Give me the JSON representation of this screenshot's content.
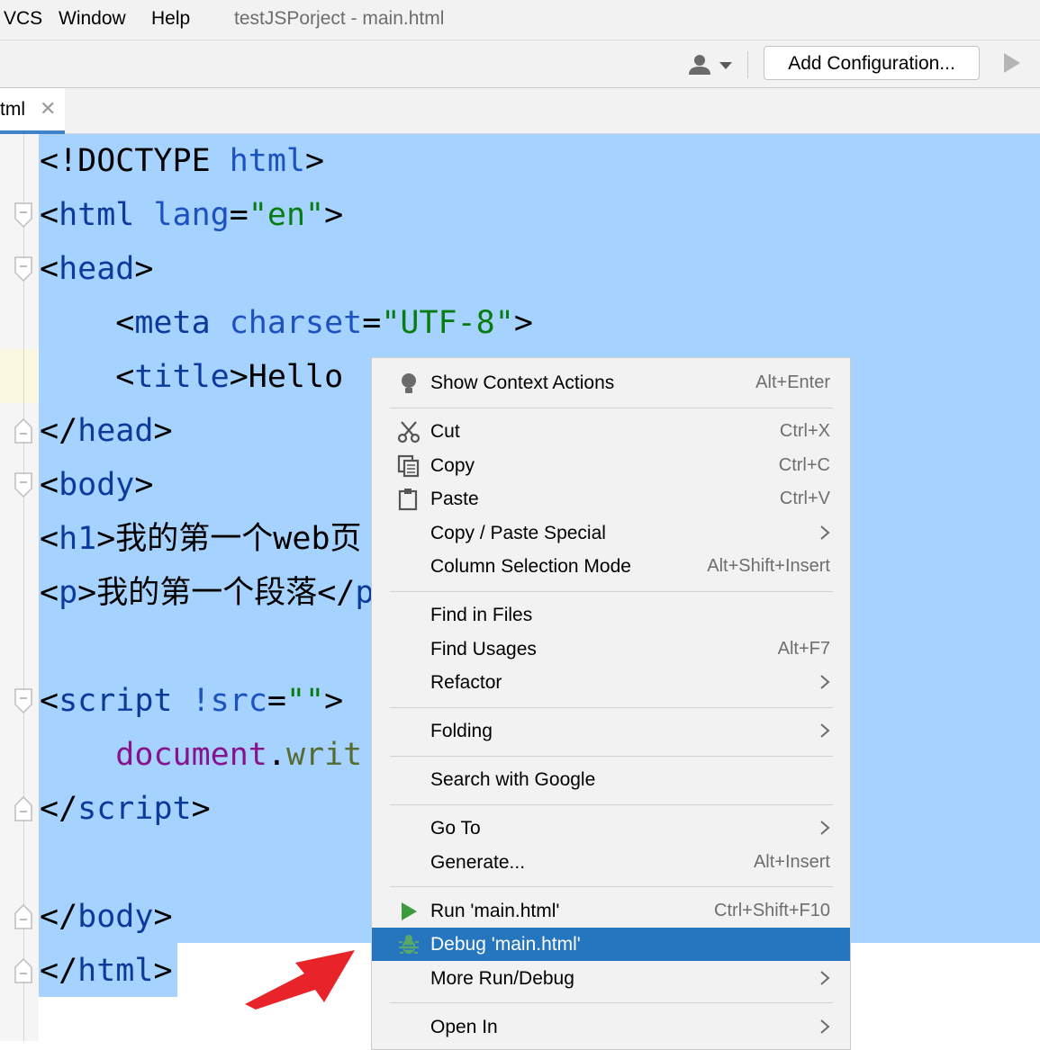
{
  "menubar": {
    "items": [
      "VCS",
      "Window",
      "Help"
    ],
    "title": "testJSPorject - main.html"
  },
  "toolbar": {
    "user_icon": "user-icon",
    "config_label": "Add Configuration...",
    "run_icon": "run-icon"
  },
  "tab": {
    "label": "tml",
    "close": "✕"
  },
  "code_lines": [
    [
      {
        "t": "<!DOCTYPE ",
        "c": ""
      },
      {
        "t": "html",
        "c": "at"
      },
      {
        "t": ">",
        "c": ""
      }
    ],
    [
      {
        "t": "<",
        "c": ""
      },
      {
        "t": "html ",
        "c": "tg"
      },
      {
        "t": "lang",
        "c": "at"
      },
      {
        "t": "=",
        "c": ""
      },
      {
        "t": "\"en\"",
        "c": "sv"
      },
      {
        "t": ">",
        "c": ""
      }
    ],
    [
      {
        "t": "<",
        "c": ""
      },
      {
        "t": "head",
        "c": "tg"
      },
      {
        "t": ">",
        "c": ""
      }
    ],
    [
      {
        "t": "    <",
        "c": ""
      },
      {
        "t": "meta ",
        "c": "tg"
      },
      {
        "t": "charset",
        "c": "at"
      },
      {
        "t": "=",
        "c": ""
      },
      {
        "t": "\"UTF-8\"",
        "c": "sv"
      },
      {
        "t": ">",
        "c": ""
      }
    ],
    [
      {
        "t": "    <",
        "c": ""
      },
      {
        "t": "title",
        "c": "tg"
      },
      {
        "t": ">Hello",
        "c": ""
      }
    ],
    [
      {
        "t": "</",
        "c": ""
      },
      {
        "t": "head",
        "c": "tg"
      },
      {
        "t": ">",
        "c": ""
      }
    ],
    [
      {
        "t": "<",
        "c": ""
      },
      {
        "t": "body",
        "c": "tg"
      },
      {
        "t": ">",
        "c": ""
      }
    ],
    [
      {
        "t": "<",
        "c": ""
      },
      {
        "t": "h1",
        "c": "tg"
      },
      {
        "t": ">我的第一个web页",
        "c": ""
      }
    ],
    [
      {
        "t": "<",
        "c": ""
      },
      {
        "t": "p",
        "c": "tg"
      },
      {
        "t": ">我的第一个段落</",
        "c": ""
      },
      {
        "t": "p",
        "c": "tg"
      }
    ],
    [],
    [
      {
        "t": "<",
        "c": ""
      },
      {
        "t": "script ",
        "c": "tg"
      },
      {
        "t": "!src",
        "c": "at"
      },
      {
        "t": "=",
        "c": ""
      },
      {
        "t": "\"\"",
        "c": "sv"
      },
      {
        "t": ">",
        "c": ""
      }
    ],
    [
      {
        "t": "    ",
        "c": ""
      },
      {
        "t": "document",
        "c": "js"
      },
      {
        "t": ".",
        "c": ""
      },
      {
        "t": "writ",
        "c": "fn"
      }
    ],
    [
      {
        "t": "</",
        "c": ""
      },
      {
        "t": "script",
        "c": "tg"
      },
      {
        "t": ">",
        "c": ""
      }
    ],
    [],
    [
      {
        "t": "</",
        "c": ""
      },
      {
        "t": "body",
        "c": "tg"
      },
      {
        "t": ">",
        "c": ""
      }
    ],
    [
      {
        "t": "</",
        "c": ""
      },
      {
        "t": "html",
        "c": "tg"
      },
      {
        "t": ">",
        "c": ""
      }
    ]
  ],
  "context_menu": {
    "items": [
      {
        "label": "Show Context Actions",
        "shortcut": "Alt+Enter",
        "icon": "lightbulb-icon"
      },
      {
        "sep": true
      },
      {
        "label": "Cut",
        "shortcut": "Ctrl+X",
        "icon": "scissors-icon"
      },
      {
        "label": "Copy",
        "shortcut": "Ctrl+C",
        "icon": "copy-icon"
      },
      {
        "label": "Paste",
        "shortcut": "Ctrl+V",
        "icon": "paste-icon"
      },
      {
        "label": "Copy / Paste Special",
        "submenu": true
      },
      {
        "label": "Column Selection Mode",
        "shortcut": "Alt+Shift+Insert"
      },
      {
        "sep": true
      },
      {
        "label": "Find in Files"
      },
      {
        "label": "Find Usages",
        "shortcut": "Alt+F7"
      },
      {
        "label": "Refactor",
        "submenu": true
      },
      {
        "sep": true
      },
      {
        "label": "Folding",
        "submenu": true
      },
      {
        "sep": true
      },
      {
        "label": "Search with Google"
      },
      {
        "sep": true
      },
      {
        "label": "Go To",
        "submenu": true
      },
      {
        "label": "Generate...",
        "shortcut": "Alt+Insert"
      },
      {
        "sep": true
      },
      {
        "label": "Run 'main.html'",
        "shortcut": "Ctrl+Shift+F10",
        "icon": "run-icon"
      },
      {
        "label": "Debug 'main.html'",
        "icon": "bug-icon",
        "highlighted": true
      },
      {
        "label": "More Run/Debug",
        "submenu": true
      },
      {
        "sep": true
      },
      {
        "label": "Open In",
        "submenu": true
      }
    ]
  },
  "colors": {
    "selection": "#a6d2ff",
    "menu_highlight": "#2675bf",
    "run_green": "#3a9c3d",
    "arrow_red": "#e8242a"
  }
}
